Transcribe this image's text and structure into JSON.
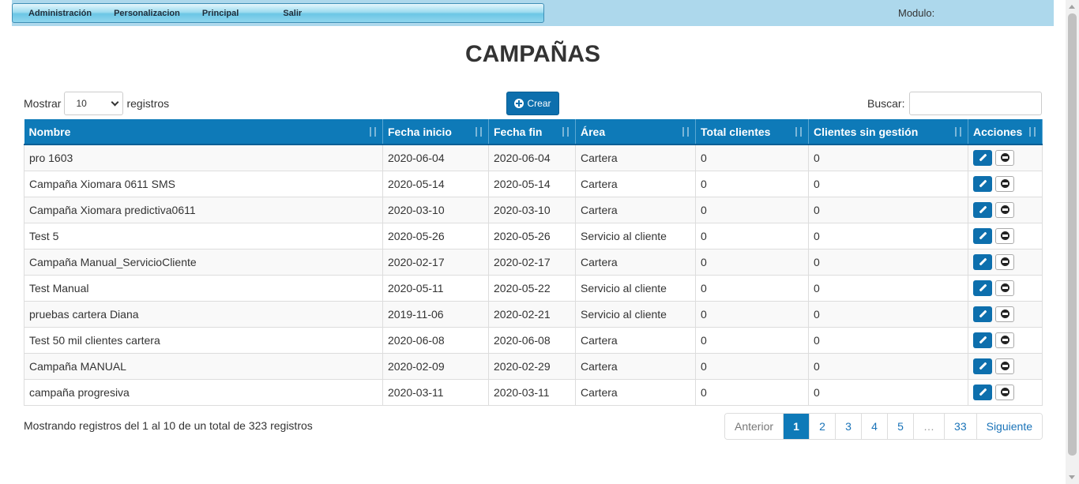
{
  "menu": {
    "items": [
      "Administración",
      "Personalizacion",
      "Principal",
      "Salir"
    ],
    "modulo_label": "Modulo:"
  },
  "page_title": "CAMPAÑAS",
  "controls": {
    "show_label": "Mostrar",
    "show_value": "10",
    "records_label": "registros",
    "create_label": "Crear",
    "search_label": "Buscar:",
    "search_value": ""
  },
  "table": {
    "headers": [
      "Nombre",
      "Fecha inicio",
      "Fecha fin",
      "Área",
      "Total clientes",
      "Clientes sin gestión",
      "Acciones"
    ],
    "rows": [
      [
        "pro 1603",
        "2020-06-04",
        "2020-06-04",
        "Cartera",
        "0",
        "0"
      ],
      [
        "Campaña Xiomara 0611 SMS",
        "2020-05-14",
        "2020-05-14",
        "Cartera",
        "0",
        "0"
      ],
      [
        "Campaña Xiomara predictiva0611",
        "2020-03-10",
        "2020-03-10",
        "Cartera",
        "0",
        "0"
      ],
      [
        "Test 5",
        "2020-05-26",
        "2020-05-26",
        "Servicio al cliente",
        "0",
        "0"
      ],
      [
        "Campaña Manual_ServicioCliente",
        "2020-02-17",
        "2020-02-17",
        "Cartera",
        "0",
        "0"
      ],
      [
        "Test Manual",
        "2020-05-11",
        "2020-05-22",
        "Servicio al cliente",
        "0",
        "0"
      ],
      [
        "pruebas cartera Diana",
        "2019-11-06",
        "2020-02-21",
        "Servicio al cliente",
        "0",
        "0"
      ],
      [
        "Test 50 mil clientes cartera",
        "2020-06-08",
        "2020-06-08",
        "Cartera",
        "0",
        "0"
      ],
      [
        "Campaña MANUAL",
        "2020-02-09",
        "2020-02-29",
        "Cartera",
        "0",
        "0"
      ],
      [
        "campaña progresiva",
        "2020-03-11",
        "2020-03-11",
        "Cartera",
        "0",
        "0"
      ]
    ]
  },
  "footer": {
    "info": "Mostrando registros del 1 al 10 de un total de 323 registros",
    "pages": [
      "Anterior",
      "1",
      "2",
      "3",
      "4",
      "5",
      "…",
      "33",
      "Siguiente"
    ],
    "active_page": "1"
  },
  "colors": {
    "header_bg": "#0e7ab8",
    "button_primary": "#0d6fad",
    "topbar_bg": "#add8ec"
  }
}
